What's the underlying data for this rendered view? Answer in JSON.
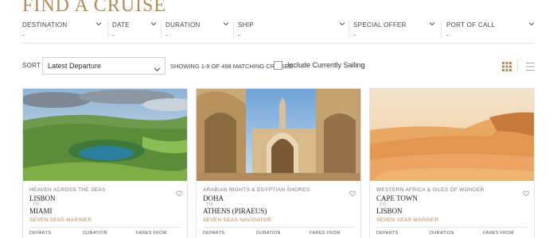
{
  "page": {
    "title": "FIND A CRUISE"
  },
  "filters": [
    {
      "label": "DESTINATION",
      "value": "-"
    },
    {
      "label": "DATE",
      "value": "-"
    },
    {
      "label": "DURATION",
      "value": "-"
    },
    {
      "label": "SHIP",
      "value": "-"
    },
    {
      "label": "SPECIAL OFFER",
      "value": "-"
    },
    {
      "label": "PORT OF CALL",
      "value": "-"
    }
  ],
  "sort": {
    "label": "SORT",
    "selected": "Latest Departure",
    "count_text": "SHOWING 1-9 OF 498 MATCHING CRUISES",
    "include_sailing_label": "Include Currently Sailing",
    "include_sailing_checked": false
  },
  "view_toggle": {
    "active": "grid",
    "icons": [
      "grid-view-icon",
      "list-view-icon"
    ]
  },
  "card_labels": {
    "to": "TO",
    "departs": "DEPARTS",
    "duration": "DURATION",
    "fares_from": "FARES FROM"
  },
  "cruises": [
    {
      "region": "HEAVEN ACROSS THE SEAS",
      "from": "LISBON",
      "to": "MIAMI",
      "ship": "SEVEN SEAS MARINER",
      "image": "green crater lake landscape"
    },
    {
      "region": "ARABIAN NIGHTS & EGYPTIAN SHORES",
      "from": "DOHA",
      "to": "ATHENS (PIRAEUS)",
      "ship": "SEVEN SEAS NAVIGATOR",
      "image": "grand mosque archway"
    },
    {
      "region": "WESTERN AFRICA & ISLES OF WONDER",
      "from": "CAPE TOWN",
      "to": "LISBON",
      "ship": "SEVEN SEAS MARINER",
      "image": "orange desert dunes"
    }
  ],
  "colors": {
    "gold": "#b08d57",
    "text": "#333333",
    "border": "#e2e2e2"
  }
}
